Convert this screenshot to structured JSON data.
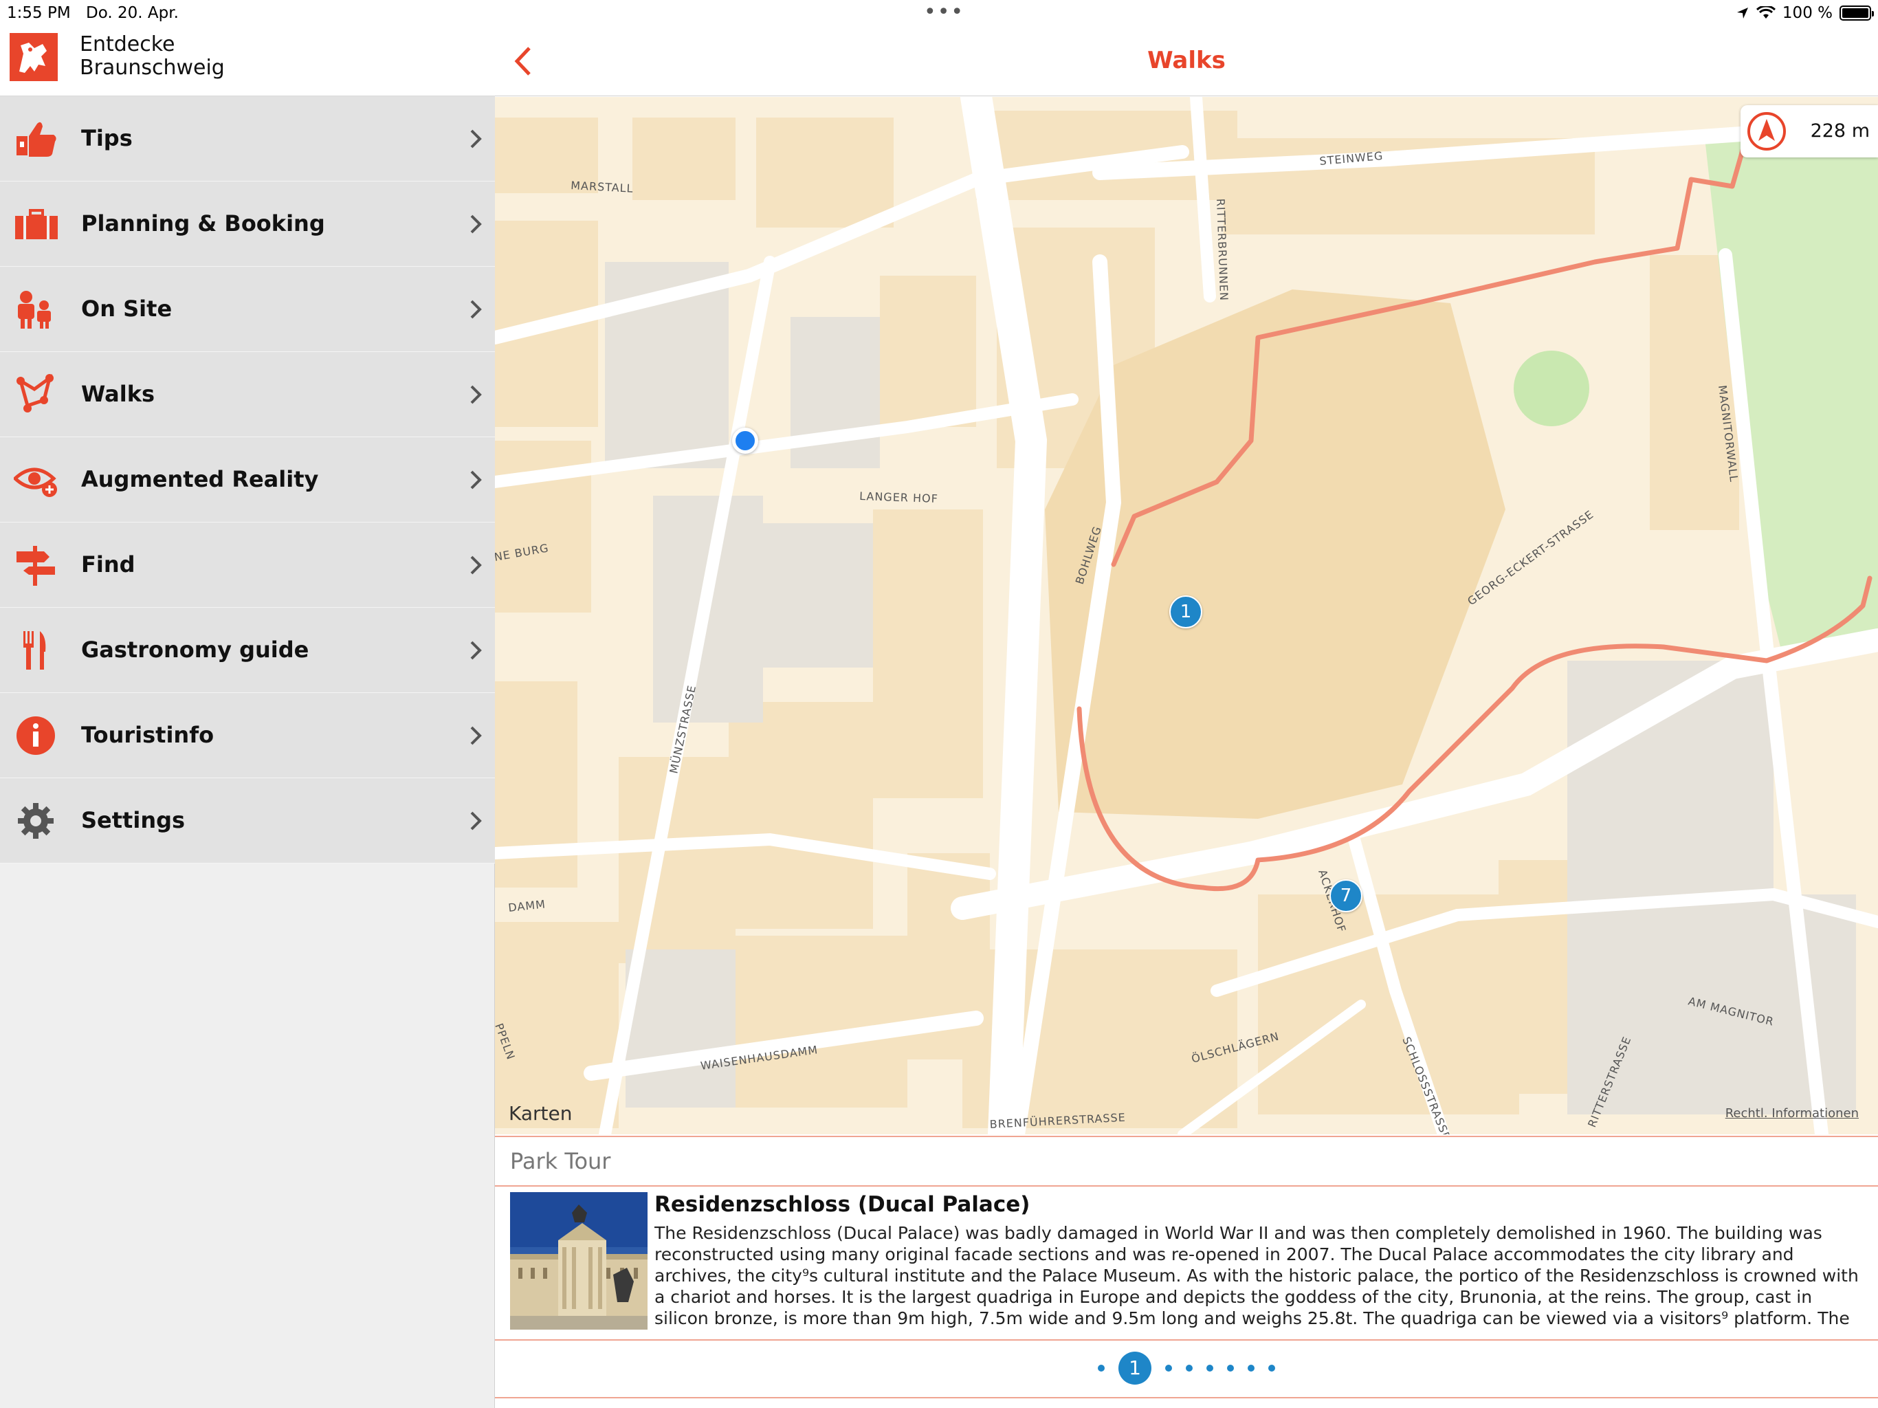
{
  "status": {
    "time": "1:55 PM",
    "date": "Do. 20. Apr.",
    "battery": "100 %"
  },
  "brand": {
    "line1": "Entdecke",
    "line2": "Braunschweig",
    "color": "#e8452b"
  },
  "menu": [
    {
      "label": "Tips",
      "icon": "thumbs-up-icon"
    },
    {
      "label": "Planning & Booking",
      "icon": "suitcase-icon"
    },
    {
      "label": "On Site",
      "icon": "people-icon"
    },
    {
      "label": "Walks",
      "icon": "route-icon"
    },
    {
      "label": "Augmented Reality",
      "icon": "eye-icon"
    },
    {
      "label": "Find",
      "icon": "signpost-icon"
    },
    {
      "label": "Gastronomy guide",
      "icon": "cutlery-icon"
    },
    {
      "label": "Touristinfo",
      "icon": "info-icon"
    },
    {
      "label": "Settings",
      "icon": "gear-icon"
    }
  ],
  "header": {
    "title": "Walks"
  },
  "map": {
    "distance": "228 m",
    "attribution": "Karten",
    "legal": "Rechtl. Informationen",
    "streets": [
      "MARSTALL",
      "STEINWEG",
      "RITTERBRUNNEN",
      "LANGER HOF",
      "NE BURG",
      "BOHLWEG",
      "MÜNZSTRASSE",
      "GEORG-ECKERT-STRASSE",
      "MAGNITORWALL",
      "DAMM",
      "WAISENHAUSDAMM",
      "ÖLSCHLÄGERN",
      "SCHLOSSSTRASSE",
      "AM MAGNITOR",
      "PPELN",
      "BRENFÜHRERSTRASSE",
      "ACKERHOF",
      "RITTERSTRASSE"
    ],
    "markers": [
      "1",
      "7"
    ],
    "route_color": "#f08a72"
  },
  "card": {
    "tour": "Park Tour",
    "title": "Residenzschloss (Ducal Palace)",
    "description": "The Residenzschloss (Ducal Palace) was badly damaged in World War II and was then completely demolished in 1960. The building was reconstructed using many original facade sections and was re-opened in 2007. The Ducal Palace accommodates the city library and archives, the city⁹s cultural institute and the Palace Museum. As with the historic palace, the portico of the Residenzschloss is crowned with a chariot and horses. It is the largest quadriga in Europe and depicts the goddess of the city, Brunonia, at the reins. The group, cast in silicon bronze, is more than 9m high, 7.5m wide and 9.5m long and weighs 25.8t. The quadriga can be viewed via a visitors⁹ platform. The entrance to the stai…",
    "page_current": "1",
    "page_count": 8
  }
}
